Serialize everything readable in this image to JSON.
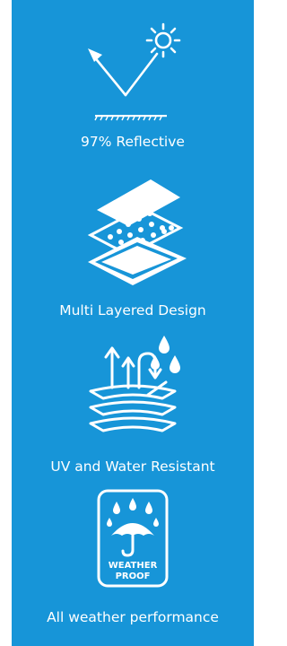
{
  "colors": {
    "panel_background": "#1795d8",
    "icon_color": "#ffffff",
    "text_color": "#ffffff"
  },
  "features": [
    {
      "icon": "sun-reflection-icon",
      "label": "97% Reflective"
    },
    {
      "icon": "layers-icon",
      "label": "Multi Layered Design"
    },
    {
      "icon": "uv-water-resistant-icon",
      "label": "UV and Water Resistant"
    },
    {
      "icon": "weather-proof-badge-icon",
      "label": "All weather performance",
      "badge_text": [
        "WEATHER",
        "PROOF"
      ]
    }
  ]
}
